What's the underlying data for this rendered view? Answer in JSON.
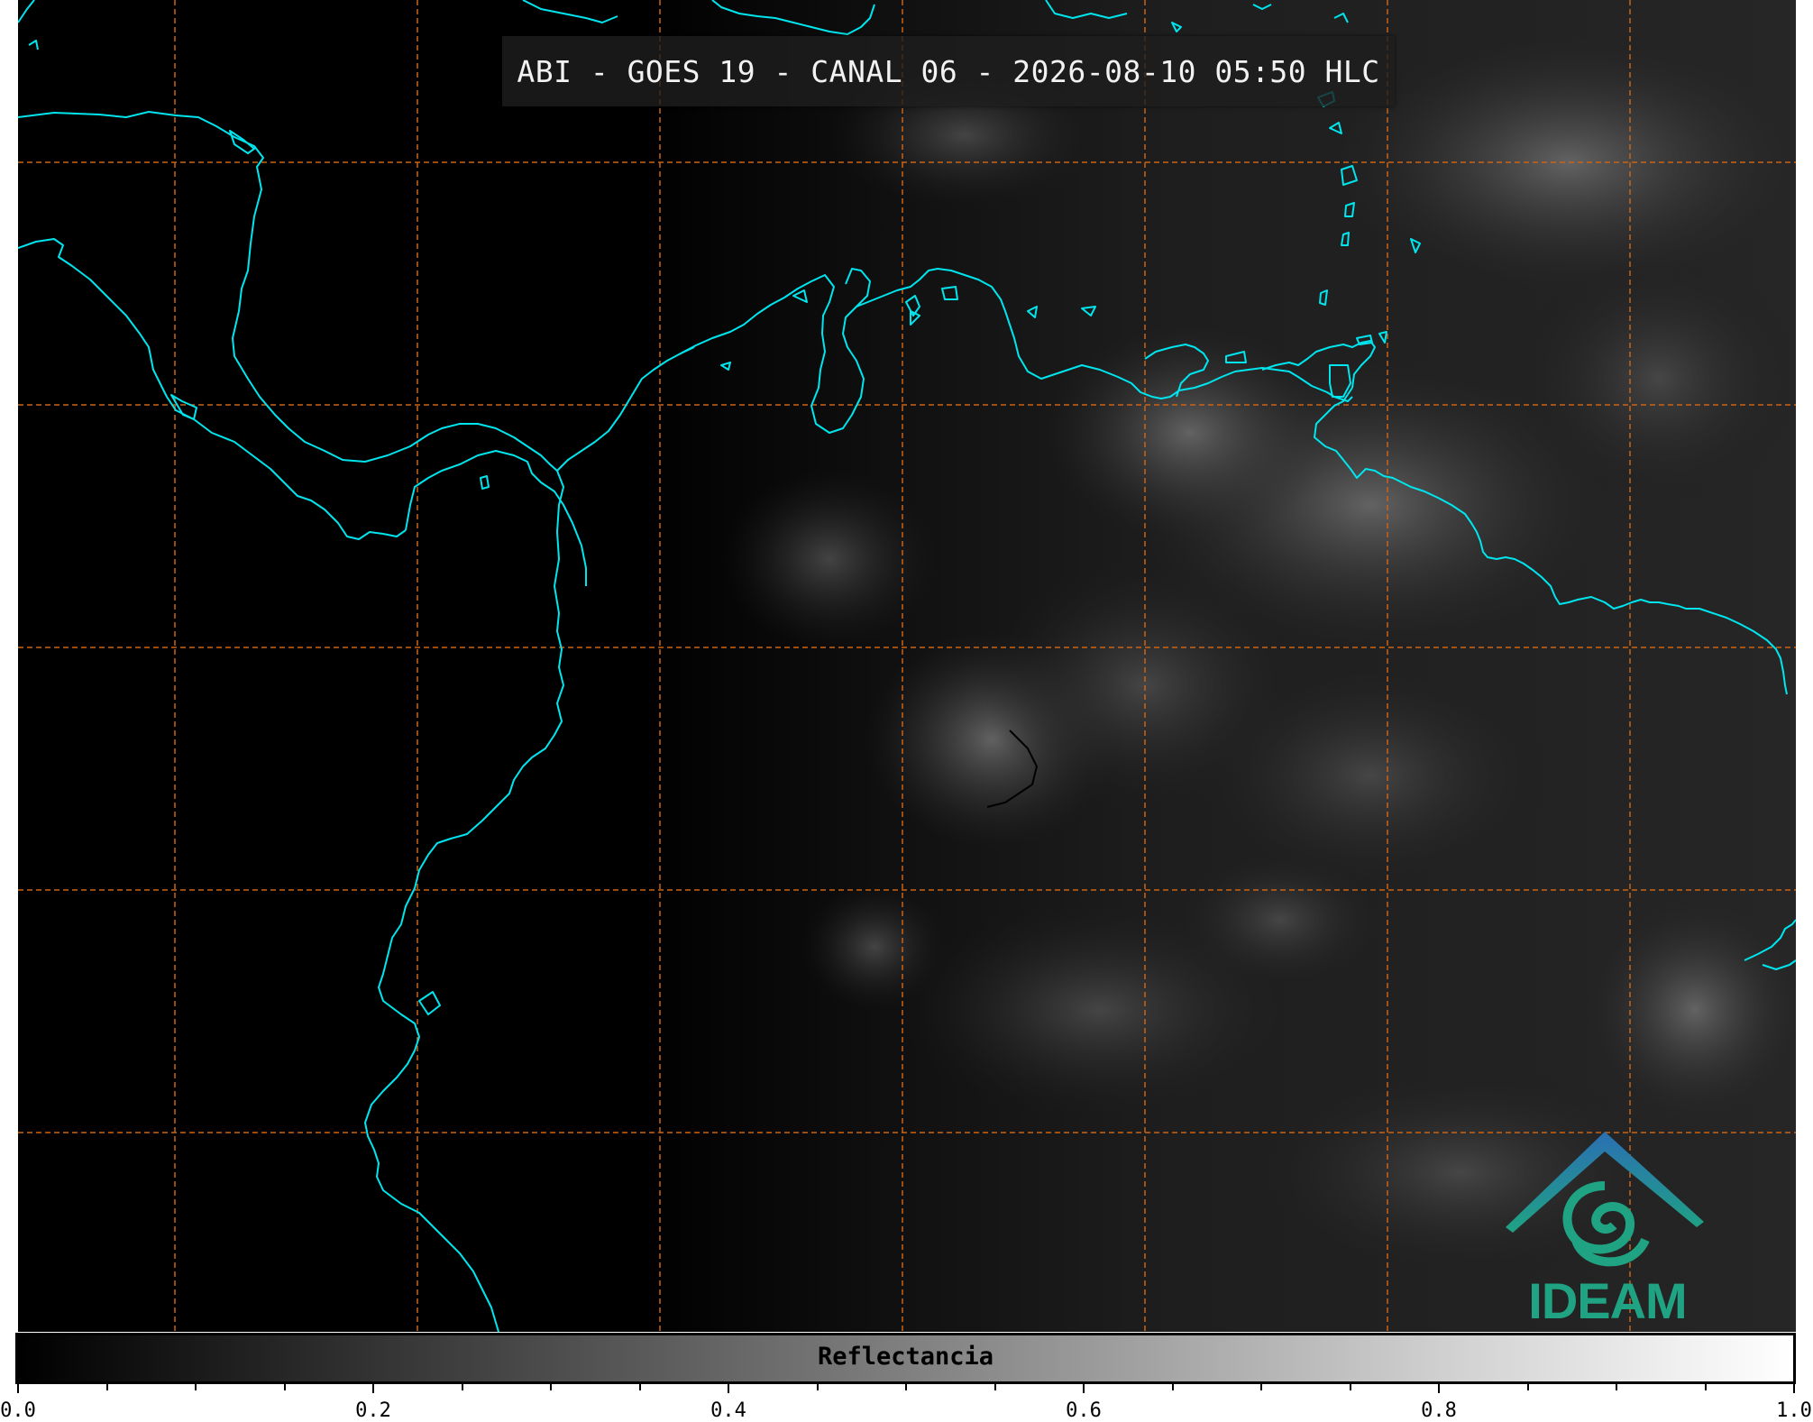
{
  "header": {
    "title": "ABI - GOES 19 - CANAL 06 - 2026-08-10 05:50 HLC"
  },
  "logo": {
    "text": "IDEAM",
    "color": "#1fa383",
    "accent_color": "#2b6fb3"
  },
  "colorbar": {
    "label": "Reflectancia",
    "tick_labels": [
      "0.0",
      "0.2",
      "0.4",
      "0.6",
      "0.8",
      "1.0"
    ],
    "range": [
      0.0,
      1.0
    ],
    "colormap": "grayscale"
  },
  "map": {
    "coastline_color": "#00e5ee",
    "gridline_color": "#c86419",
    "background_color": "#000000"
  }
}
